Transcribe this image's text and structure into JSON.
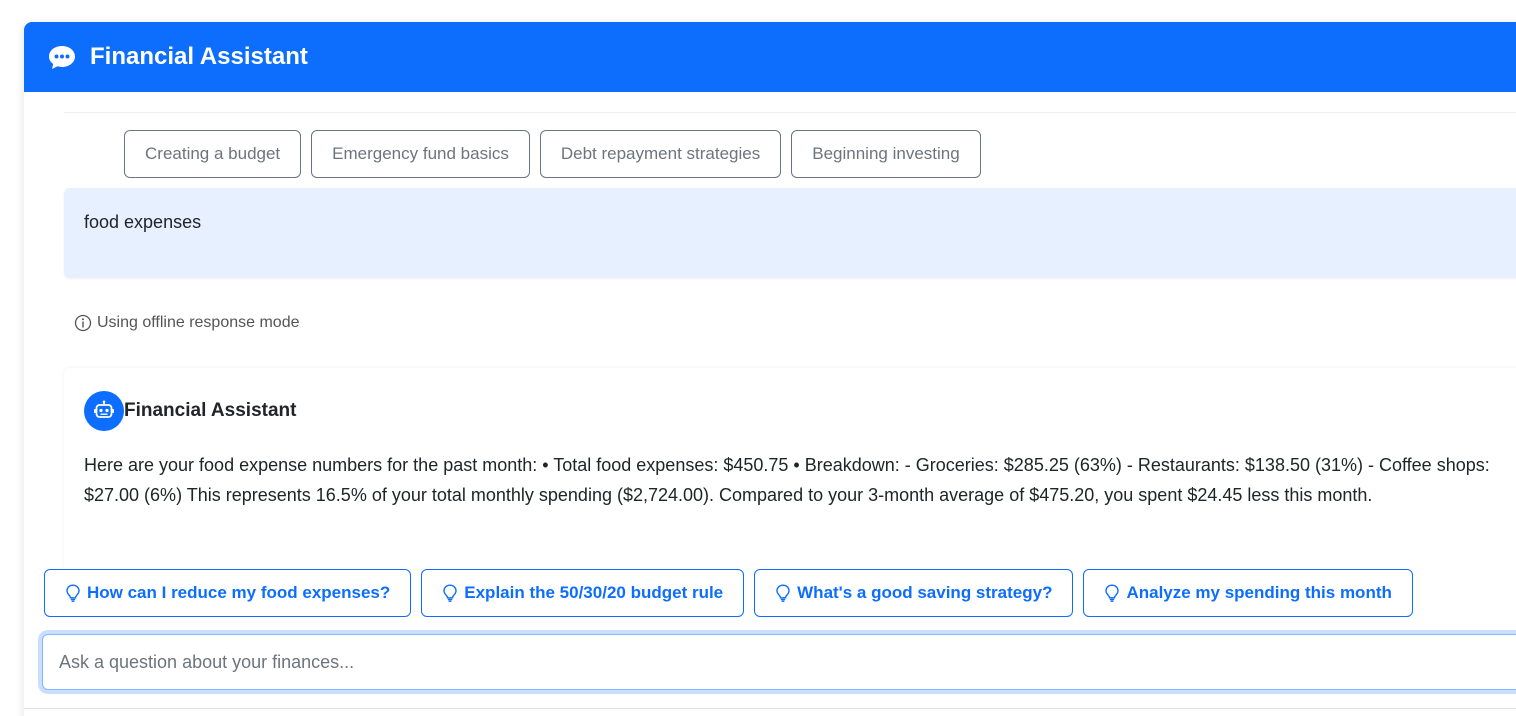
{
  "header": {
    "title": "Financial Assistant",
    "icon": "chat-bubble-icon"
  },
  "topics": [
    {
      "label": "Creating a budget"
    },
    {
      "label": "Emergency fund basics"
    },
    {
      "label": "Debt repayment strategies"
    },
    {
      "label": "Beginning investing"
    }
  ],
  "user_message": {
    "text": "food expenses"
  },
  "status_note": {
    "icon": "info-icon",
    "text": "Using offline response mode"
  },
  "bot_message": {
    "name": "Financial Assistant",
    "avatar_icon": "robot-icon",
    "text": "Here are your food expense numbers for the past month: • Total food expenses: $450.75 • Breakdown: - Groceries: $285.25 (63%) - Restaurants: $138.50 (31%) - Coffee shops: $27.00 (6%) This represents 16.5% of your total monthly spending ($2,724.00). Compared to your 3-month average of $475.20, you spent $24.45 less this month."
  },
  "suggestions": [
    {
      "label": "How can I reduce my food expenses?",
      "icon": "lightbulb-icon"
    },
    {
      "label": "Explain the 50/30/20 budget rule",
      "icon": "lightbulb-icon"
    },
    {
      "label": "What's a good saving strategy?",
      "icon": "lightbulb-icon"
    },
    {
      "label": "Analyze my spending this month",
      "icon": "lightbulb-icon"
    }
  ],
  "input": {
    "placeholder": "Ask a question about your finances...",
    "value": ""
  },
  "colors": {
    "primary": "#0d6efd",
    "user_bubble": "#e7f0fe",
    "secondary": "#6c757d"
  }
}
